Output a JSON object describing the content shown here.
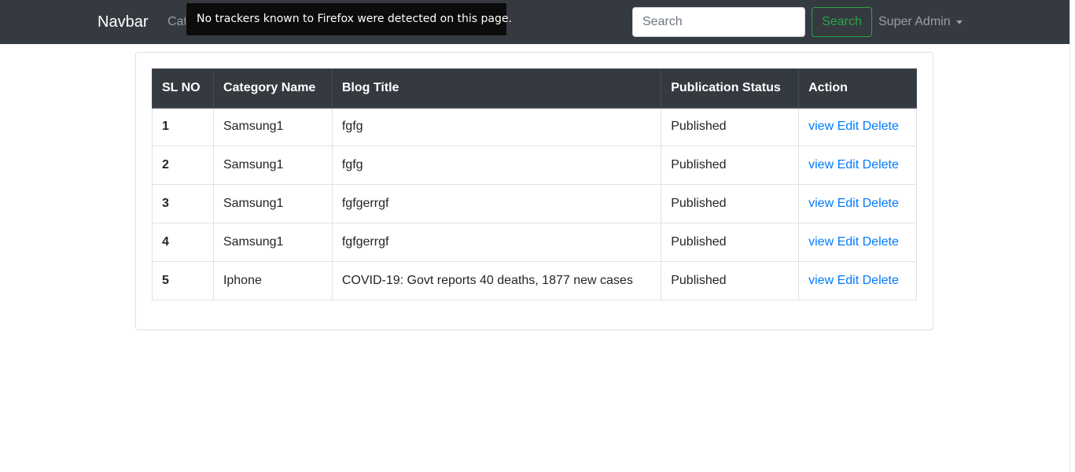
{
  "navbar": {
    "brand": "Navbar",
    "link_visible": "Cat",
    "search_placeholder": "Search",
    "search_button": "Search",
    "user_menu": "Super Admin"
  },
  "tooltip": {
    "text": "No trackers known to Firefox were detected on this page."
  },
  "table": {
    "headers": [
      "SL NO",
      "Category Name",
      "Blog Title",
      "Publication Status",
      "Action"
    ],
    "actions": {
      "view": "view",
      "edit": "Edit",
      "delete": "Delete"
    },
    "rows": [
      {
        "sl": "1",
        "category": "Samsung1",
        "title": "fgfg",
        "status": "Published"
      },
      {
        "sl": "2",
        "category": "Samsung1",
        "title": "fgfg",
        "status": "Published"
      },
      {
        "sl": "3",
        "category": "Samsung1",
        "title": "fgfgerrgf",
        "status": "Published"
      },
      {
        "sl": "4",
        "category": "Samsung1",
        "title": "fgfgerrgf",
        "status": "Published"
      },
      {
        "sl": "5",
        "category": "Iphone",
        "title": "COVID-19: Govt reports 40 deaths, 1877 new cases",
        "status": "Published"
      }
    ]
  },
  "colors": {
    "navbar_bg": "#343a40",
    "link": "#007bff",
    "search_button": "#28a745"
  }
}
